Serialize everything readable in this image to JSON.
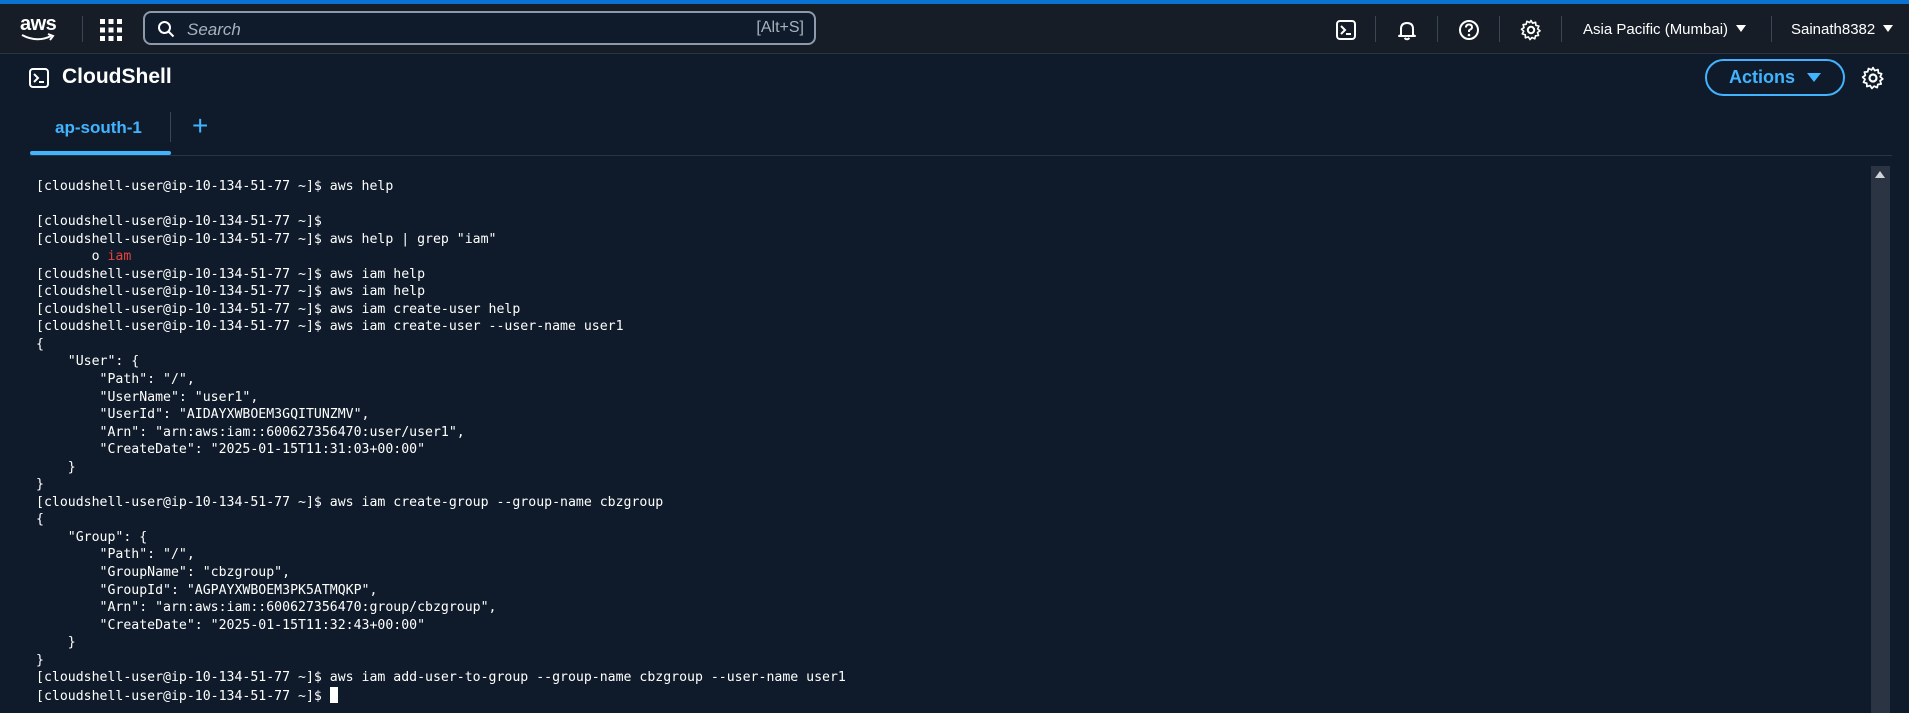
{
  "navbar": {
    "logo_text": "aws",
    "search_placeholder": "Search",
    "search_shortcut": "[Alt+S]",
    "icons": [
      "cloudshell-icon",
      "bell-icon",
      "help-icon",
      "gear-icon"
    ],
    "region": "Asia Pacific (Mumbai)",
    "user": "Sainath8382"
  },
  "header": {
    "title": "CloudShell",
    "actions_label": "Actions",
    "tabs": [
      {
        "label": "ap-south-1",
        "active": true
      }
    ],
    "add_tab_label": "+"
  },
  "colors": {
    "accent": "#42b4ff",
    "background": "#0f1b2a",
    "navbar": "#161d26",
    "highlight": "#e8423c"
  },
  "terminal": {
    "lines": [
      "[cloudshell-user@ip-10-134-51-77 ~]$ aws help",
      "",
      "[cloudshell-user@ip-10-134-51-77 ~]$",
      "[cloudshell-user@ip-10-134-51-77 ~]$ aws help | grep \"iam\"",
      "       o ",
      "[cloudshell-user@ip-10-134-51-77 ~]$ aws iam help",
      "[cloudshell-user@ip-10-134-51-77 ~]$ aws iam help",
      "[cloudshell-user@ip-10-134-51-77 ~]$ aws iam create-user help",
      "[cloudshell-user@ip-10-134-51-77 ~]$ aws iam create-user --user-name user1",
      "{",
      "    \"User\": {",
      "        \"Path\": \"/\",",
      "        \"UserName\": \"user1\",",
      "        \"UserId\": \"AIDAYXWBOEM3GQITUNZMV\",",
      "        \"Arn\": \"arn:aws:iam::600627356470:user/user1\",",
      "        \"CreateDate\": \"2025-01-15T11:31:03+00:00\"",
      "    }",
      "}",
      "[cloudshell-user@ip-10-134-51-77 ~]$ aws iam create-group --group-name cbzgroup",
      "{",
      "    \"Group\": {",
      "        \"Path\": \"/\",",
      "        \"GroupName\": \"cbzgroup\",",
      "        \"GroupId\": \"AGPAYXWBOEM3PK5ATMQKP\",",
      "        \"Arn\": \"arn:aws:iam::600627356470:group/cbzgroup\",",
      "        \"CreateDate\": \"2025-01-15T11:32:43+00:00\"",
      "    }",
      "}",
      "[cloudshell-user@ip-10-134-51-77 ~]$ aws iam add-user-to-group --group-name cbzgroup --user-name user1",
      "[cloudshell-user@ip-10-134-51-77 ~]$ "
    ],
    "highlight_text": "iam"
  }
}
